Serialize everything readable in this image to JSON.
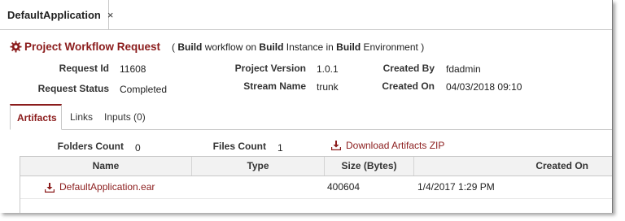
{
  "app_tab": {
    "label": "DefaultApplication",
    "close": "×"
  },
  "header": {
    "title": "Project Workflow Request",
    "subtitle_open": "(",
    "subtitle_b1": "Build",
    "subtitle_t1": "workflow on",
    "subtitle_b2": "Build",
    "subtitle_t2": "Instance in",
    "subtitle_b3": "Build",
    "subtitle_t3": "Environment",
    "subtitle_close": ")"
  },
  "details": {
    "request_id_label": "Request Id",
    "request_id": "11608",
    "request_status_label": "Request Status",
    "request_status": "Completed",
    "project_version_label": "Project Version",
    "project_version": "1.0.1",
    "stream_name_label": "Stream Name",
    "stream_name": "trunk",
    "created_by_label": "Created By",
    "created_by": "fdadmin",
    "created_on_label": "Created On",
    "created_on": "04/03/2018 09:10"
  },
  "tabs": [
    "Artifacts",
    "Links",
    "Inputs (0)"
  ],
  "counts": {
    "folders_label": "Folders Count",
    "folders": "0",
    "files_label": "Files Count",
    "files": "1",
    "download_zip": "Download Artifacts ZIP"
  },
  "table": {
    "headers": [
      "Name",
      "Type",
      "Size (Bytes)",
      "Created On"
    ],
    "rows": [
      {
        "name": "DefaultApplication.ear",
        "type": "",
        "size": "400604",
        "created_on": "1/4/2017 1:29 PM"
      }
    ]
  },
  "colors": {
    "accent": "#8b1c1c",
    "border": "#c8c8c8",
    "header_bg": "#f2f2f2"
  },
  "icons": {
    "title_icon": "gear-icon",
    "download_icon": "download-icon"
  }
}
